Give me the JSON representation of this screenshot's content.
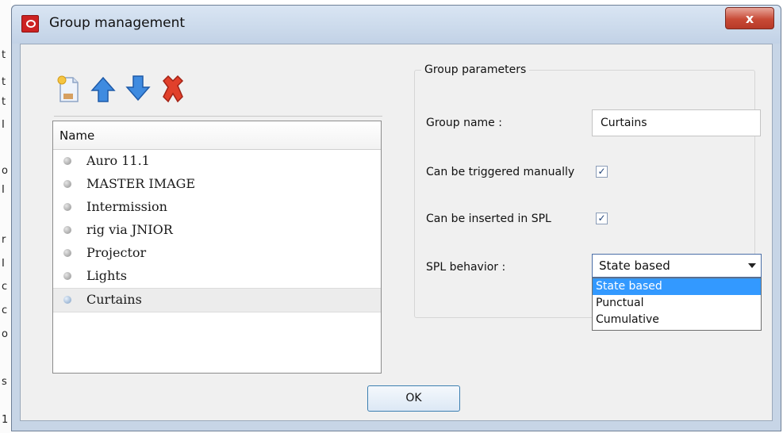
{
  "background_glyphs": [
    "t",
    "t",
    "t",
    "I",
    "o",
    "I",
    "r",
    "I",
    "c",
    "c",
    "o",
    "s",
    "1"
  ],
  "window": {
    "title": "Group management",
    "close_label": "x",
    "colors": {
      "title_gradient_top": "#d9e5f3",
      "close_red": "#c84a36",
      "selection_blue": "#3399ff"
    }
  },
  "toolbar": {
    "icons": [
      "new-group-icon",
      "move-up-arrow-icon",
      "move-down-arrow-icon",
      "delete-x-icon"
    ]
  },
  "group_list": {
    "header": "Name",
    "items": [
      {
        "label": "Auro 11.1",
        "selected": false
      },
      {
        "label": "MASTER IMAGE",
        "selected": false
      },
      {
        "label": "Intermission",
        "selected": false
      },
      {
        "label": "rig via JNIOR",
        "selected": false
      },
      {
        "label": "Projector",
        "selected": false
      },
      {
        "label": "Lights",
        "selected": false
      },
      {
        "label": "Curtains",
        "selected": true
      }
    ]
  },
  "params": {
    "legend": "Group parameters",
    "group_name_label": "Group name :",
    "group_name_value": "Curtains",
    "manual_trigger_label": "Can be triggered manually",
    "manual_trigger_checked": "✓",
    "spl_insert_label": "Can be inserted in SPL",
    "spl_insert_checked": "✓",
    "spl_behavior_label": "SPL behavior :",
    "spl_behavior_selected": "State based",
    "spl_behavior_options": [
      "State based",
      "Punctual",
      "Cumulative"
    ]
  },
  "ok_label": "OK"
}
